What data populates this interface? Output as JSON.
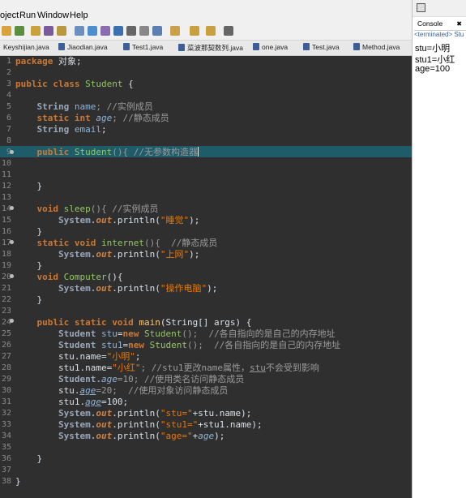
{
  "menu": [
    "oject",
    "Run",
    "Window",
    "Help"
  ],
  "tabs": [
    "Keyshijian.java",
    "Jiaodian.java",
    "Test1.java",
    "菜波那契数列.java",
    "one.java",
    "Test.java",
    "Method.java"
  ],
  "console": {
    "title": "Console",
    "close": "✖",
    "status": "<terminated> Stu",
    "lines": [
      "stu=小明",
      "stu1=小红",
      "age=100"
    ]
  },
  "editor": {
    "line_numbers": [
      "1",
      "2",
      "3",
      "4",
      "5",
      "6",
      "7",
      "8",
      "9",
      "10",
      "11",
      "12",
      "13",
      "14",
      "15",
      "16",
      "17",
      "18",
      "19",
      "20",
      "21",
      "22",
      "23",
      "24",
      "25",
      "26",
      "27",
      "28",
      "29",
      "30",
      "31",
      "32",
      "33",
      "34",
      "35",
      "36",
      "37",
      "38"
    ],
    "code": {
      "pkg": "package",
      "pkg_name": " 对象;",
      "l3a": "public class",
      "l3b": " Student",
      "l3c": " {",
      "l5a": "    String",
      "l5b": " name",
      "l5c": "; //实例成员",
      "l6a": "    static int",
      "l6b": " age",
      "l6c": "; //静态成员",
      "l7a": "    String",
      "l7b": " email",
      "l7c": ";",
      "l9a": "    public",
      "l9b": " Student",
      "l9c": "(){ //无参数构造器",
      "l13": "    }",
      "l14a": "    void",
      "l14b": " sleep",
      "l14c": "(){ //实例成员",
      "l15a": "        System.",
      "l15b": "out",
      "l15c": ".println(",
      "l15d": "\"睡觉\"",
      "l15e": ");",
      "l16": "    }",
      "l17a": "    static void",
      "l17b": " internet",
      "l17c": "(){  //静态成员",
      "l18a": "        System.",
      "l18b": "out",
      "l18c": ".println(",
      "l18d": "\"上网\"",
      "l18e": ");",
      "l19": "    }",
      "l20a": "    void",
      "l20b": " Computer",
      "l20c": "(){",
      "l21a": "        System.",
      "l21b": "out",
      "l21c": ".println(",
      "l21d": "\"操作电脑\"",
      "l21e": ");",
      "l22": "    }",
      "l24a": "    public static void",
      "l24b": " main",
      "l24c": "(String[] args) {",
      "l25a": "        Student",
      "l25b": " stu",
      "l25c": "=",
      "l25d": "new",
      "l25e": " Student",
      "l25f": "();  //各自指向的是自己的内存地址",
      "l26a": "        Student",
      "l26b": " stu1",
      "l26c": "=",
      "l26d": "new",
      "l26e": " Student",
      "l26f": "();  //各自指向的是自己的内存地址",
      "l27a": "        stu.name=",
      "l27b": "\"小明\"",
      "l27c": ";",
      "l28a": "        stu1.name=",
      "l28b": "\"小红\"",
      "l28c": "; //stu1更改name属性，",
      "l28d": "stu",
      "l28e": "不会受到影响",
      "l29a": "        Student.",
      "l29b": "age",
      "l29c": "=10; //使用类名访问静态成员",
      "l30a": "        stu.",
      "l30b": "age",
      "l30c": "=20;  //使用对象访问静态成员",
      "l31a": "        stu1.",
      "l31b": "age",
      "l31c": "=100;",
      "l32a": "        System.",
      "l32b": "out",
      "l32c": ".println(",
      "l32d": "\"stu=\"",
      "l32e": "+stu.name);",
      "l33a": "        System.",
      "l33b": "out",
      "l33c": ".println(",
      "l33d": "\"stu1=\"",
      "l33e": "+stu1.name);",
      "l34a": "        System.",
      "l34b": "out",
      "l34c": ".println(",
      "l34d": "\"age=\"",
      "l34e": "+",
      "l34f": "age",
      "l34g": ");",
      "l36": "    }",
      "l38": "}"
    }
  }
}
